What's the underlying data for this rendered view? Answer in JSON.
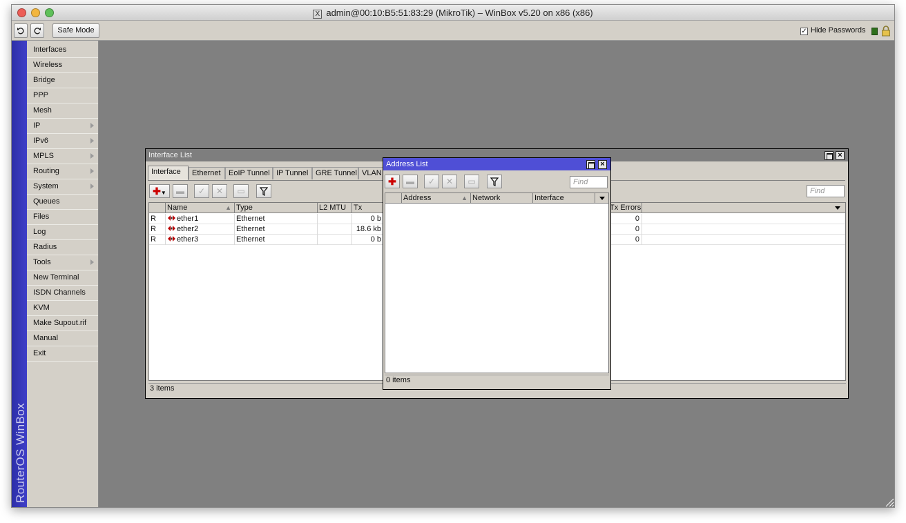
{
  "window": {
    "title": "admin@00:10:B5:51:83:29 (MikroTik) – WinBox v5.20 on x86 (x86)",
    "title_icon_glyph": "X"
  },
  "toolbar": {
    "undo_icon": "undo-icon",
    "redo_icon": "redo-icon",
    "safe_mode_label": "Safe Mode",
    "hide_passwords_label": "Hide Passwords",
    "hide_passwords_checked": true,
    "status_color": "#2e6f1b"
  },
  "sidebar": {
    "brand": "RouterOS WinBox",
    "brand_color": "#3a3ab8",
    "items": [
      {
        "label": "Interfaces",
        "submenu": false
      },
      {
        "label": "Wireless",
        "submenu": false
      },
      {
        "label": "Bridge",
        "submenu": false
      },
      {
        "label": "PPP",
        "submenu": false
      },
      {
        "label": "Mesh",
        "submenu": false
      },
      {
        "label": "IP",
        "submenu": true
      },
      {
        "label": "IPv6",
        "submenu": true
      },
      {
        "label": "MPLS",
        "submenu": true
      },
      {
        "label": "Routing",
        "submenu": true
      },
      {
        "label": "System",
        "submenu": true
      },
      {
        "label": "Queues",
        "submenu": false
      },
      {
        "label": "Files",
        "submenu": false
      },
      {
        "label": "Log",
        "submenu": false
      },
      {
        "label": "Radius",
        "submenu": false
      },
      {
        "label": "Tools",
        "submenu": true
      },
      {
        "label": "New Terminal",
        "submenu": false
      },
      {
        "label": "ISDN Channels",
        "submenu": false
      },
      {
        "label": "KVM",
        "submenu": false
      },
      {
        "label": "Make Supout.rif",
        "submenu": false
      },
      {
        "label": "Manual",
        "submenu": false
      },
      {
        "label": "Exit",
        "submenu": false
      }
    ]
  },
  "interface_list": {
    "title": "Interface List",
    "tabs": [
      "Interface",
      "Ethernet",
      "EoIP Tunnel",
      "IP Tunnel",
      "GRE Tunnel",
      "VLAN"
    ],
    "active_tab": "Interface",
    "find_placeholder": "Find",
    "columns": {
      "flag": "",
      "name": "Name",
      "type": "Type",
      "l2mtu": "L2 MTU",
      "tx": "Tx",
      "tx_errors": "Tx Errors"
    },
    "rows": [
      {
        "flag": "R",
        "name": "ether1",
        "type": "Ethernet",
        "l2mtu": "",
        "tx": "0 b",
        "tx_errors": "0"
      },
      {
        "flag": "R",
        "name": "ether2",
        "type": "Ethernet",
        "l2mtu": "",
        "tx": "18.6 kb",
        "tx_errors": "0"
      },
      {
        "flag": "R",
        "name": "ether3",
        "type": "Ethernet",
        "l2mtu": "",
        "tx": "0 b",
        "tx_errors": "0"
      }
    ],
    "status": "3 items"
  },
  "address_list": {
    "title": "Address List",
    "title_color": "#4f4fd6",
    "find_placeholder": "Find",
    "columns": {
      "flag": "",
      "address": "Address",
      "network": "Network",
      "interface": "Interface"
    },
    "rows": [],
    "status": "0 items"
  }
}
